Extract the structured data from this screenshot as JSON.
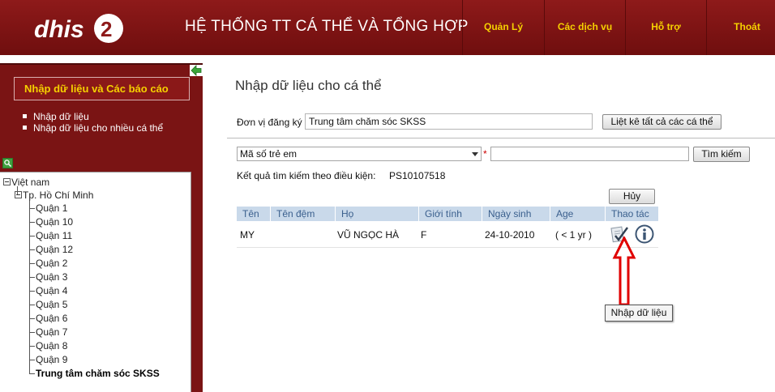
{
  "header": {
    "logo_text": "dhis2",
    "title": "HỆ THỐNG TT CÁ THỂ VÀ TỔNG HỢP",
    "menu": [
      {
        "label": "Quản Lý"
      },
      {
        "label": "Các dịch vụ"
      },
      {
        "label": "Hỗ trợ"
      },
      {
        "label": "Thoát"
      }
    ]
  },
  "sidebar": {
    "section_title": "Nhập dữ liệu và Các báo cáo",
    "links": [
      {
        "label": "Nhập dữ liệu"
      },
      {
        "label": "Nhập dữ liệu cho nhiều cá thể"
      }
    ],
    "tree": {
      "root": "Việt nam",
      "city": "Tp. Hồ Chí Minh",
      "units": [
        "Quận 1",
        "Quận 10",
        "Quận 11",
        "Quận 12",
        "Quận 2",
        "Quận 3",
        "Quận 4",
        "Quận 5",
        "Quận 6",
        "Quận 7",
        "Quận 8",
        "Quận 9"
      ],
      "selected_unit": "Trung tâm chăm sóc SKSS"
    }
  },
  "main": {
    "title": "Nhập dữ liệu cho cá thể",
    "org_label": "Đơn vị đăng ký",
    "org_value": "Trung tâm chăm sóc SKSS",
    "list_all_button": "Liệt kê tất cả các cá thể",
    "attribute_selected": "Mã số trẻ em",
    "required_marker": "*",
    "search_value": "",
    "search_button": "Tìm kiếm",
    "result_label": "Kết quả tìm kiếm theo điều kiện:",
    "result_value": "PS10107518",
    "cancel_button": "Hủy",
    "table": {
      "headers": [
        "Tên",
        "Tên đệm",
        "Họ",
        "Giới tính",
        "Ngày sinh",
        "Age",
        "Thao tác"
      ],
      "rows": [
        {
          "ten": "MY",
          "ten_dem": "",
          "ho": "VŨ NGỌC HÀ",
          "gioi_tinh": "F",
          "ngay_sinh": "24-10-2010",
          "age": "( < 1 yr )"
        }
      ]
    },
    "tooltip": "Nhập dữ liệu"
  },
  "colors": {
    "header_bg": "#7d1212",
    "menu_text": "#f5d000",
    "table_header_bg": "#c9d9ea",
    "table_header_text": "#3a5f8d",
    "annotation_arrow": "#e00000"
  }
}
